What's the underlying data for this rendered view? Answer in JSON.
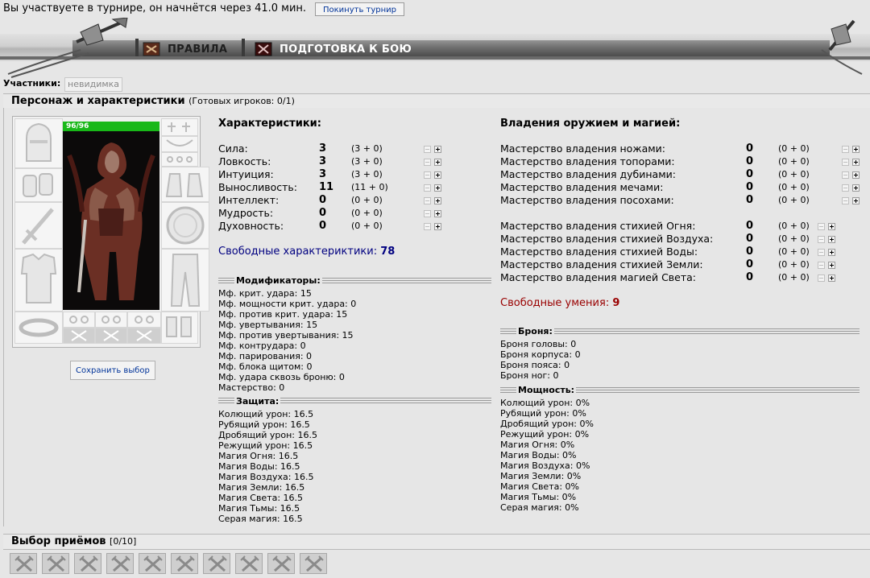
{
  "notice": {
    "text": "Вы участвуете в турнире, он начнётся через 41.0 мин.",
    "leave_button": "Покинуть турнир"
  },
  "nav": {
    "rules": "ПРАВИЛА",
    "prepare": "ПОДГОТОВКА К БОЮ"
  },
  "participants": {
    "label": "Участники:",
    "player": "невидимка"
  },
  "character_panel": {
    "title": "Персонаж и характеристики",
    "ready": "(Готовых игроков: 0/1)"
  },
  "hp": "96/96",
  "save_button": "Сохранить выбор",
  "stats": {
    "heading": "Характеристики:",
    "rows": [
      {
        "name": "Сила:",
        "value": "3",
        "breakdown": "(3 + 0)"
      },
      {
        "name": "Ловкость:",
        "value": "3",
        "breakdown": "(3 + 0)"
      },
      {
        "name": "Интуиция:",
        "value": "3",
        "breakdown": "(3 + 0)"
      },
      {
        "name": "Выносливость:",
        "value": "11",
        "breakdown": "(11 + 0)"
      },
      {
        "name": "Интеллект:",
        "value": "0",
        "breakdown": "(0 + 0)"
      },
      {
        "name": "Мудрость:",
        "value": "0",
        "breakdown": "(0 + 0)"
      },
      {
        "name": "Духовность:",
        "value": "0",
        "breakdown": "(0 + 0)"
      }
    ],
    "free_label": "Свободные характериктики:",
    "free_value": "78"
  },
  "modifiers": {
    "heading": "Модификаторы:",
    "items": [
      "Мф. крит. удара: 15",
      "Мф. мощности крит. удара: 0",
      "Мф. против крит. удара: 15",
      "Мф. увертывания: 15",
      "Мф. против увертывания: 15",
      "Мф. контрудара: 0",
      "Мф. парирования: 0",
      "Мф. блока щитом: 0",
      "Мф. удара сквозь броню: 0",
      "Мастерство: 0"
    ]
  },
  "defense": {
    "heading": "Защита:",
    "items": [
      "Колющий урон: 16.5",
      "Рубящий урон: 16.5",
      "Дробящий урон: 16.5",
      "Режущий урон: 16.5",
      "Магия Огня: 16.5",
      "Магия Воды: 16.5",
      "Магия Воздуха: 16.5",
      "Магия Земли: 16.5",
      "Магия Света: 16.5",
      "Магия Тьмы: 16.5",
      "Серая магия: 16.5"
    ]
  },
  "mastery": {
    "heading": "Владения оружием и магией:",
    "weapons": [
      {
        "name": "Мастерство владения ножами:",
        "value": "0",
        "breakdown": "(0 + 0)"
      },
      {
        "name": "Мастерство владения топорами:",
        "value": "0",
        "breakdown": "(0 + 0)"
      },
      {
        "name": "Мастерство владения дубинами:",
        "value": "0",
        "breakdown": "(0 + 0)"
      },
      {
        "name": "Мастерство владения мечами:",
        "value": "0",
        "breakdown": "(0 + 0)"
      },
      {
        "name": "Мастерство владения посохами:",
        "value": "0",
        "breakdown": "(0 + 0)"
      }
    ],
    "magic": [
      {
        "name": "Мастерство владения стихией Огня:",
        "value": "0",
        "breakdown": "(0 + 0)"
      },
      {
        "name": "Мастерство владения стихией Воздуха:",
        "value": "0",
        "breakdown": "(0 + 0)"
      },
      {
        "name": "Мастерство владения стихией Воды:",
        "value": "0",
        "breakdown": "(0 + 0)"
      },
      {
        "name": "Мастерство владения стихией Земли:",
        "value": "0",
        "breakdown": "(0 + 0)"
      },
      {
        "name": "Мастерство владения магией Света:",
        "value": "0",
        "breakdown": "(0 + 0)"
      }
    ],
    "free_label": "Свободные умения:",
    "free_value": "9"
  },
  "armor": {
    "heading": "Броня:",
    "items": [
      "Броня головы: 0",
      "Броня корпуса: 0",
      "Броня пояса: 0",
      "Броня ног: 0"
    ]
  },
  "power": {
    "heading": "Мощность:",
    "items": [
      "Колющий урон: 0%",
      "Рубящий урон: 0%",
      "Дробящий урон: 0%",
      "Режущий урон: 0%",
      "Магия Огня: 0%",
      "Магия Воды: 0%",
      "Магия Воздуха: 0%",
      "Магия Земли: 0%",
      "Магия Света: 0%",
      "Магия Тьмы: 0%",
      "Серая магия: 0%"
    ]
  },
  "techniques": {
    "title": "Выбор приёмов",
    "count": "[0/10]",
    "slots": 10
  },
  "colors": {
    "free_stats": "#000080",
    "free_skills": "#990000",
    "hp_bar": "#18b818",
    "link": "#003399"
  }
}
